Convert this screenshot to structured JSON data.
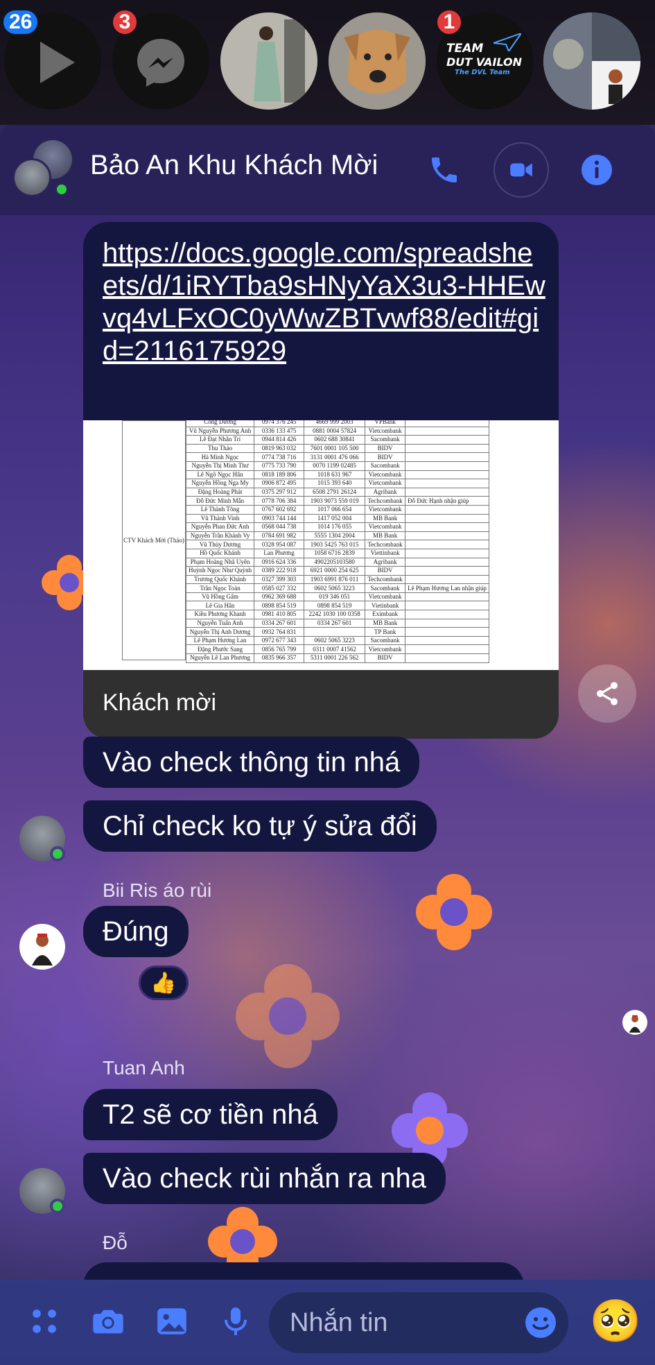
{
  "chat_heads": [
    {
      "name": "video-app",
      "badge": "26"
    },
    {
      "name": "messenger-app",
      "badge": "3"
    },
    {
      "name": "contact-woman",
      "badge": ""
    },
    {
      "name": "contact-dog",
      "badge": ""
    },
    {
      "name": "team-dvl",
      "badge": "1",
      "logo_line1": "TEAM",
      "logo_line2": "DUT VAILON",
      "logo_line3": "The DVL Team"
    },
    {
      "name": "group-collage",
      "badge": ""
    }
  ],
  "header": {
    "title": "Bảo An Khu Khách Mời",
    "icons": [
      "phone-icon",
      "video-call-icon",
      "info-icon"
    ]
  },
  "link_card": {
    "url_text": "https://docs.google.com/spreadsheets/d/1iRYTba9sHNyYaX3u3-HHEwvq4vLFxOC0yWwZBTvwf88/edit#gid=2116175929",
    "caption": "Khách mời",
    "group_label": "CTV Khách Mời (Thảo)",
    "rows": [
      [
        "Công Dương",
        "0974 376 245",
        "4669 999 2003",
        "VPBank",
        ""
      ],
      [
        "Vũ Nguyễn Phương Anh",
        "0336 133 475",
        "0881 0004 57824",
        "Vietcombank",
        ""
      ],
      [
        "Lê Đạt Nhân Trí",
        "0944 814 426",
        "0602 688 30841",
        "Sacombank",
        ""
      ],
      [
        "Thu Thảo",
        "0819 963 032",
        "7601 0001 105 500",
        "BIDV",
        ""
      ],
      [
        "Hà Minh Ngọc",
        "0774 738 716",
        "3131 0001 476 066",
        "BIDV",
        ""
      ],
      [
        "Nguyễn Thị Minh Thư",
        "0775 733 790",
        "0070 1199 02485",
        "Sacombank",
        ""
      ],
      [
        "Lê Ngô Ngọc Hân",
        "0818 189 806",
        "1018 631 967",
        "Vietcombank",
        ""
      ],
      [
        "Nguyễn Hồng Nga My",
        "0906 872 495",
        "1015 393 640",
        "Vietcombank",
        ""
      ],
      [
        "Đặng Hoàng Phát",
        "0375 297 912",
        "6508 2791 26124",
        "Agribank",
        ""
      ],
      [
        "Đỗ Đức Minh Mẫn",
        "0778 706 384",
        "1903 9073 559 019",
        "Techcombank",
        "Đỗ Đức Hạnh nhận giúp"
      ],
      [
        "Lê Thành Tông",
        "0767 602 692",
        "1017 066 654",
        "Vietcombank",
        ""
      ],
      [
        "Vũ Thành Vinh",
        "0903 744 144",
        "1417 052 004",
        "MB Bank",
        ""
      ],
      [
        "Nguyễn Phan Đức Anh",
        "0568 044 738",
        "1014 176 055",
        "Vietcombank",
        ""
      ],
      [
        "Nguyễn Trần Khánh Vy",
        "0784 691 982",
        "5555 1304 2004",
        "MB Bank",
        ""
      ],
      [
        "Vũ Thùy Dương",
        "0328 954 087",
        "1903 5425 763 015",
        "Techcombank",
        ""
      ],
      [
        "Hồ Quốc Khánh",
        "Lan Phương",
        "1058 6716 2839",
        "Viettinbank",
        ""
      ],
      [
        "Phạm Hoàng Nhã Uyên",
        "0916 624 336",
        "4902205103580",
        "Agribank",
        ""
      ],
      [
        "Huỳnh Ngọc Như Quỳnh",
        "0389 222 918",
        "6921 0000 254 625",
        "BIDV",
        ""
      ],
      [
        "Trương Quốc Khánh",
        "0327 399 303",
        "1903 6991 876 011",
        "Techcombank",
        ""
      ],
      [
        "Trần Ngọc Toàn",
        "0585 027 332",
        "0602 5065 3223",
        "Sacombank",
        "Lê Phạm Hương Lan nhận giúp"
      ],
      [
        "Vũ Hồng Gấm",
        "0962 369 688",
        "019 346 051",
        "Vietcombank",
        ""
      ],
      [
        "Lê Gia Hân",
        "0898 854 519",
        "0898 854 519",
        "Vietinbank",
        ""
      ],
      [
        "Kiều Phương Khanh",
        "0981 410 805",
        "2242 1030 100 0358",
        "Eximbank",
        ""
      ],
      [
        "Nguyễn Tuấn Anh",
        "0334 267 601",
        "0334 267 601",
        "MB Bank",
        ""
      ],
      [
        "Nguyễn Thị Anh Dương",
        "0932 764 831",
        "",
        "TP Bank",
        ""
      ],
      [
        "Lê Phạm Hương Lan",
        "0972 677 343",
        "0602 5065 3223",
        "Sacombank",
        ""
      ],
      [
        "Đặng Phước Sang",
        "0856 765 799",
        "0311 0007 41562",
        "Vietcombank",
        ""
      ],
      [
        "Nguyễn Lê Lan Phương",
        "0835 966 357",
        "5311 0001 226 562",
        "BIDV",
        ""
      ]
    ]
  },
  "messages": {
    "m1": "Vào check thông tin nhá",
    "m2": "Chỉ check ko tự ý sửa đổi",
    "sender_bii": "Bii Ris áo rùi",
    "m3": "Đúng",
    "m3_reaction": "👍",
    "sender_tuan": "Tuan Anh",
    "m4": "T2 sẽ cơ tiền nhá",
    "m5": "Vào check rùi nhắn ra nha",
    "sender_do": "Đỗ"
  },
  "composer": {
    "placeholder": "Nhắn tin",
    "icons": [
      "apps-icon",
      "camera-icon",
      "image-icon",
      "mic-icon",
      "emoji-icon",
      "pleading-face-emoji"
    ],
    "quick_reaction": "🥺"
  },
  "colors": {
    "bubble": "#13163f",
    "accent": "#4a7dff",
    "online": "#31cc46",
    "badge_blue": "#1877f2",
    "badge_red": "#e23a3a"
  }
}
